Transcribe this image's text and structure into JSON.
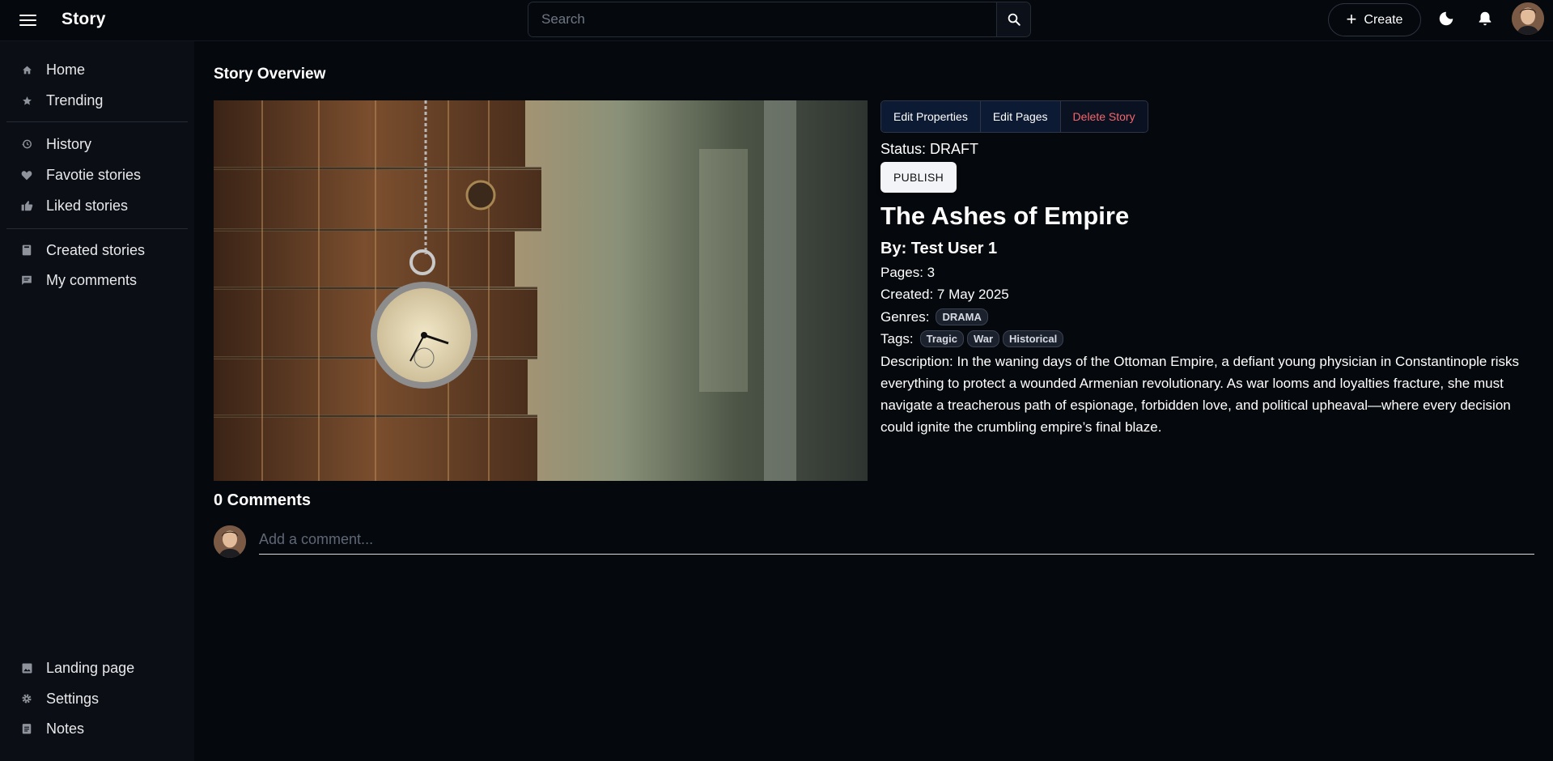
{
  "header": {
    "brand": "Story",
    "search_placeholder": "Search",
    "create_label": "Create"
  },
  "sidebar": {
    "items": [
      {
        "label": "Home",
        "icon": "home-icon"
      },
      {
        "label": "Trending",
        "icon": "star-icon"
      },
      {
        "label": "History",
        "icon": "history-icon"
      },
      {
        "label": "Favotie stories",
        "icon": "heart-icon"
      },
      {
        "label": "Liked stories",
        "icon": "thumbs-up-icon"
      },
      {
        "label": "Created stories",
        "icon": "book-icon"
      },
      {
        "label": "My comments",
        "icon": "comment-icon"
      }
    ],
    "footer_items": [
      {
        "label": "Landing page",
        "icon": "image-icon"
      },
      {
        "label": "Settings",
        "icon": "gear-icon"
      },
      {
        "label": "Notes",
        "icon": "note-icon"
      }
    ]
  },
  "main": {
    "page_title": "Story Overview",
    "actions": {
      "edit_properties": "Edit Properties",
      "edit_pages": "Edit Pages",
      "delete_story": "Delete Story"
    },
    "status_label": "Status: DRAFT",
    "publish_label": "PUBLISH",
    "story": {
      "title": "The Ashes of Empire",
      "byline": "By: Test User 1",
      "pages": "Pages: 3",
      "created": "Created: 7 May 2025",
      "genres_label": "Genres:",
      "genres": [
        "DRAMA"
      ],
      "tags_label": "Tags:",
      "tags": [
        "Tragic",
        "War",
        "Historical"
      ],
      "description": "Description: In the waning days of the Ottoman Empire, a defiant young physician in Constantinople risks everything to protect a wounded Armenian revolutionary. As war looms and loyalties fracture, she must navigate a treacherous path of espionage, forbidden love, and political upheaval—where every decision could ignite the crumbling empire’s final blaze."
    },
    "comments": {
      "title": "0 Comments",
      "placeholder": "Add a comment..."
    }
  },
  "colors": {
    "background": "#05080d",
    "sidebar": "#0b0e14",
    "danger": "#f5666b",
    "action_bg": "#0c1a33"
  }
}
